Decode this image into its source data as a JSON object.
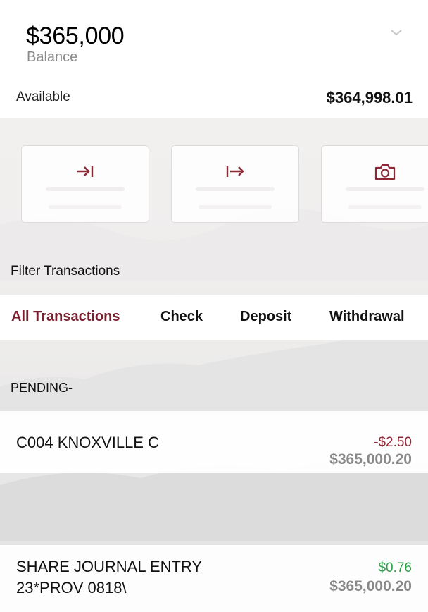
{
  "account": {
    "balance_amount": "$365,000",
    "balance_label": "Balance",
    "available_label": "Available",
    "available_value": "$364,998.01"
  },
  "actions": [
    {
      "icon": "transfer-in-icon"
    },
    {
      "icon": "transfer-out-icon"
    },
    {
      "icon": "camera-icon"
    }
  ],
  "filter": {
    "title": "Filter Transactions",
    "tabs": [
      "All Transactions",
      "Check",
      "Deposit",
      "Withdrawal"
    ],
    "active_tab": "All Transactions"
  },
  "pending": {
    "label": "PENDING-"
  },
  "transactions": [
    {
      "description": "C004 KNOXVILLE C",
      "amount": "-$2.50",
      "balance": "$365,000.20"
    },
    {
      "description_line1": "SHARE JOURNAL ENTRY",
      "description_line2": "23*PROV 0818\\",
      "amount": "$0.76",
      "balance": "$365,000.20"
    }
  ],
  "colors": {
    "accent": "#7a1f2f",
    "negative": "#8b2a36",
    "positive": "#2ea04a",
    "muted": "#888888"
  }
}
